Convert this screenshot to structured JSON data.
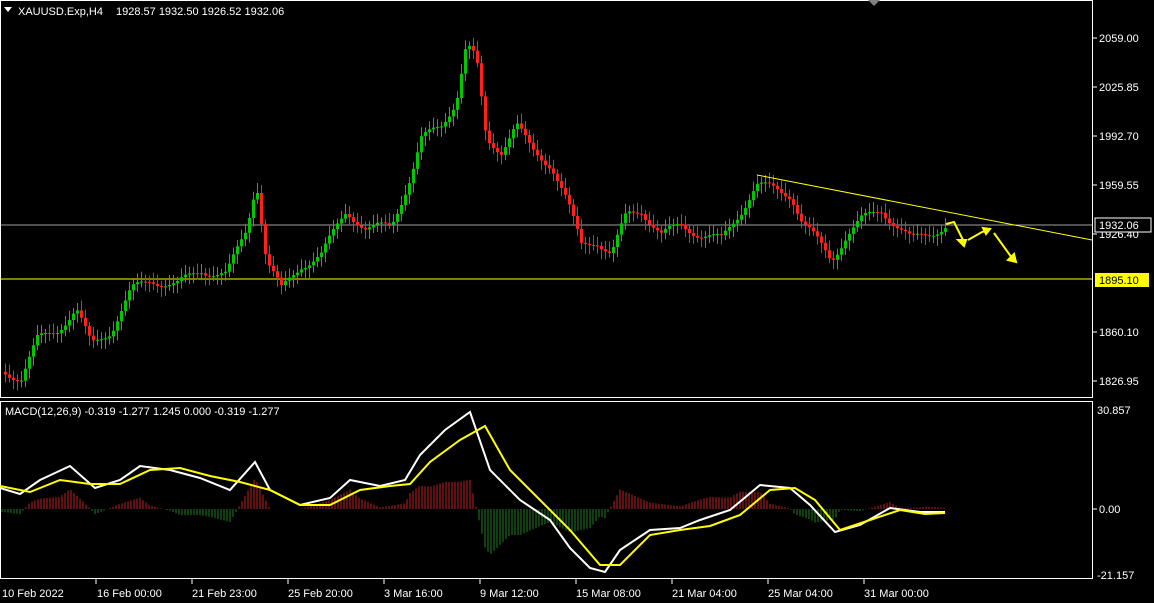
{
  "header": {
    "symbol_label": "XAUUSD.Exp,H4",
    "ohlc": "1928.57 1932.50 1926.52 1932.06"
  },
  "macd": {
    "label": "MACD(12,26,9) -0.319 -1.277 1.245 0.000 -0.319 -1.277",
    "axis_top": "30.857",
    "axis_zero": "0.00",
    "axis_bottom": "-21.157"
  },
  "price_axis": {
    "ticks": [
      "2059.00",
      "2025.85",
      "1992.70",
      "1959.55",
      "1926.40",
      "1860.10",
      "1826.95"
    ],
    "current_price": "1932.06",
    "support_level": "1895.10"
  },
  "time_axis": {
    "ticks": [
      "10 Feb 2022",
      "16 Feb 00:00",
      "21 Feb 23:00",
      "25 Feb 20:00",
      "3 Mar 16:00",
      "9 Mar 12:00",
      "15 Mar 08:00",
      "21 Mar 04:00",
      "25 Mar 04:00",
      "31 Mar 00:00"
    ]
  },
  "colors": {
    "background": "#000000",
    "bull_candle": "#00c800",
    "bear_candle": "#ff2020",
    "signal_line": "#ffff00",
    "macd_line": "#ffffff",
    "support_line": "#ffff00",
    "price_line": "#a0a0a0",
    "support_label_bg": "#ffff00"
  },
  "icons": {
    "menu": "triangle-down-icon",
    "scroll_marker": "triangle-down-icon"
  }
}
